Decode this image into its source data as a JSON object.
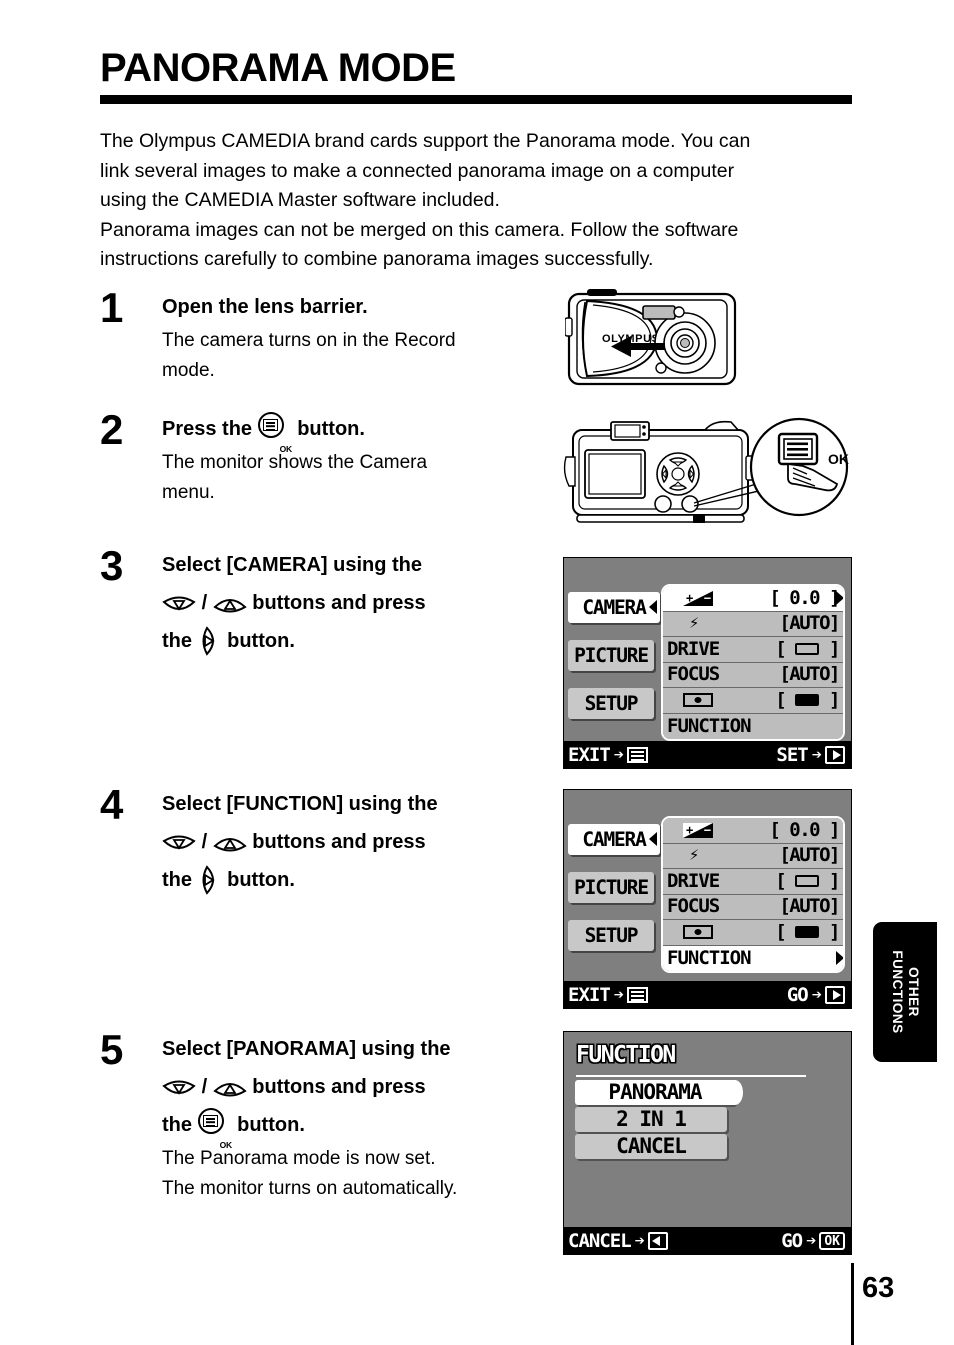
{
  "header": {
    "title": "PANORAMA MODE"
  },
  "intro": {
    "lines": [
      "The Olympus CAMEDIA brand cards support the Panorama mode. You can",
      "link several images to make a connected  panorama image on a computer",
      "using the CAMEDIA Master software included.",
      "Panorama images can not be merged on this camera.  Follow the software",
      "instructions carefully to combine panorama images successfully."
    ]
  },
  "steps": [
    {
      "number": "1",
      "head_text": "Open the lens barrier.",
      "desc_lines": [
        "The camera turns on in the Record",
        "mode."
      ]
    },
    {
      "number": "2",
      "head_pre": "Press the",
      "head_post": "button.",
      "desc_lines": [
        "The monitor shows the Camera",
        "menu."
      ]
    },
    {
      "number": "3",
      "head_line1": "Select [CAMERA] using the",
      "head_line2_post": "buttons and press",
      "head_line3_pre": "the",
      "head_line3_post": "button.",
      "separator": "/"
    },
    {
      "number": "4",
      "head_line1": "Select [FUNCTION] using the",
      "head_line2_post": "buttons and press",
      "head_line3_pre": "the",
      "head_line3_post": "button.",
      "separator": "/"
    },
    {
      "number": "5",
      "head_line1": "Select [PANORAMA] using the",
      "head_line2_post": "buttons and press",
      "head_line3_pre": "the",
      "head_line3_post": "button.",
      "separator": "/",
      "desc_lines": [
        "The Panorama mode is now set.",
        "The monitor turns on automatically."
      ]
    }
  ],
  "lcd_camera_menu": {
    "tabs": [
      {
        "label": "CAMERA",
        "selected": true
      },
      {
        "label": "PICTURE",
        "selected": false
      },
      {
        "label": "SETUP",
        "selected": false
      }
    ],
    "rows": [
      {
        "icon": "exposure-compensation-icon",
        "label": "",
        "value": "[   0.0   ]",
        "highlighted": true
      },
      {
        "icon": "flash-icon",
        "label": "",
        "value": "[AUTO]",
        "highlighted": false
      },
      {
        "icon": "",
        "label": "DRIVE",
        "value_icon": "single-frame-icon",
        "value": "[         ]",
        "highlighted": false
      },
      {
        "icon": "",
        "label": "FOCUS",
        "value": "[AUTO]",
        "highlighted": false
      },
      {
        "icon": "spot-metering-icon",
        "label": "",
        "value_icon": "filled-box-icon",
        "value": "[         ]",
        "highlighted": false
      },
      {
        "icon": "",
        "label": "FUNCTION",
        "value": "",
        "highlighted": false
      }
    ],
    "footer_left": "EXIT",
    "footer_left_icon": "menu-button-icon",
    "footer_right": "SET",
    "footer_right_icon": "right-arrow-button-icon",
    "footer_arrow": "➔"
  },
  "lcd_function_selected": {
    "tabs": [
      {
        "label": "CAMERA",
        "selected": true
      },
      {
        "label": "PICTURE",
        "selected": false
      },
      {
        "label": "SETUP",
        "selected": false
      }
    ],
    "rows": [
      {
        "icon": "exposure-compensation-icon",
        "label": "",
        "value": "[   0.0   ]",
        "highlighted": false
      },
      {
        "icon": "flash-icon",
        "label": "",
        "value": "[AUTO]",
        "highlighted": false
      },
      {
        "icon": "",
        "label": "DRIVE",
        "value_icon": "single-frame-icon",
        "value": "[         ]",
        "highlighted": false
      },
      {
        "icon": "",
        "label": "FOCUS",
        "value": "[AUTO]",
        "highlighted": false
      },
      {
        "icon": "spot-metering-icon",
        "label": "",
        "value_icon": "filled-box-icon",
        "value": "[         ]",
        "highlighted": false
      },
      {
        "icon": "",
        "label": "FUNCTION",
        "value": "",
        "highlighted": true
      }
    ],
    "footer_left": "EXIT",
    "footer_left_icon": "menu-button-icon",
    "footer_right": "GO",
    "footer_right_icon": "right-arrow-button-icon",
    "footer_arrow": "➔"
  },
  "lcd_function_menu": {
    "title": "FUNCTION",
    "items": [
      {
        "label": "PANORAMA",
        "selected": true
      },
      {
        "label": "2  IN  1",
        "selected": false
      },
      {
        "label": "CANCEL",
        "selected": false
      }
    ],
    "footer_left": "CANCEL",
    "footer_left_icon": "left-arrow-button-icon",
    "footer_right": "GO",
    "footer_right_icon": "ok-button-icon",
    "footer_right_icon_label": "OK",
    "footer_arrow": "➔"
  },
  "illustrations": {
    "front_camera": {
      "brand": "OLYMPUS",
      "name": "camera-front-lens-barrier"
    },
    "rear_camera": {
      "callout_label": "OK",
      "name": "camera-rear-menu-button"
    }
  },
  "side_tab": {
    "line1": "OTHER",
    "line2": "FUNCTIONS"
  },
  "page_number": "63"
}
